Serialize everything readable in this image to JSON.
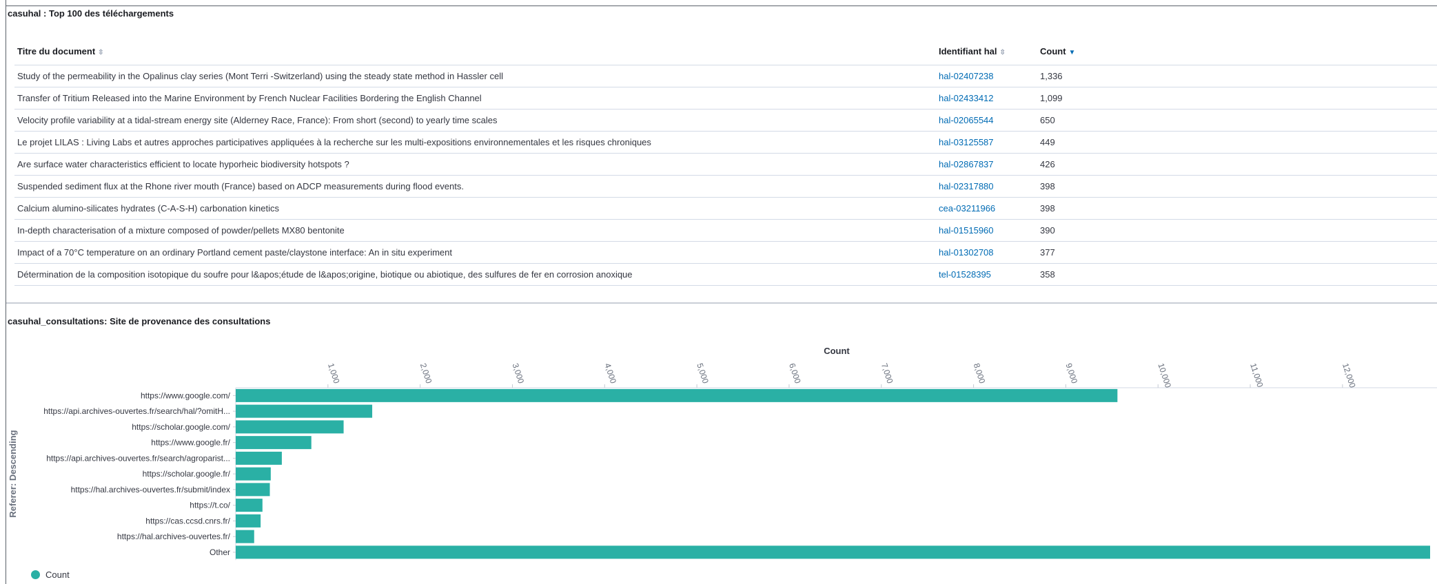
{
  "table_panel": {
    "title": "casuhal : Top 100 des téléchargements",
    "columns": {
      "title": "Titre du document",
      "id": "Identifiant hal",
      "count": "Count"
    },
    "rows": [
      {
        "title": "Study of the permeability in the Opalinus clay series (Mont Terri -Switzerland) using the steady state method in Hassler cell",
        "id": "hal-02407238",
        "count": "1,336"
      },
      {
        "title": "Transfer of Tritium Released into the Marine Environment by French Nuclear Facilities Bordering the English Channel",
        "id": "hal-02433412",
        "count": "1,099"
      },
      {
        "title": "Velocity profile variability at a tidal-stream energy site (Alderney Race, France): From short (second) to yearly time scales",
        "id": "hal-02065544",
        "count": "650"
      },
      {
        "title": "Le projet LILAS : Living Labs et autres approches participatives appliquées à la recherche sur les multi-expositions environnementales et les risques chroniques",
        "id": "hal-03125587",
        "count": "449"
      },
      {
        "title": "Are surface water characteristics efficient to locate hyporheic biodiversity hotspots ?",
        "id": "hal-02867837",
        "count": "426"
      },
      {
        "title": "Suspended sediment flux at the Rhone river mouth (France) based on ADCP measurements during flood events.",
        "id": "hal-02317880",
        "count": "398"
      },
      {
        "title": "Calcium alumino-silicates hydrates (C-A-S-H) carbonation kinetics",
        "id": "cea-03211966",
        "count": "398"
      },
      {
        "title": "In-depth characterisation of a mixture composed of powder/pellets MX80 bentonite",
        "id": "hal-01515960",
        "count": "390"
      },
      {
        "title": "Impact of a 70°C temperature on an ordinary Portland cement paste/claystone interface: An in situ experiment",
        "id": "hal-01302708",
        "count": "377"
      },
      {
        "title": "Détermination de la composition isotopique du soufre pour l&apos;étude de l&apos;origine, biotique ou abiotique, des sulfures de fer en corrosion anoxique",
        "id": "tel-01528395",
        "count": "358"
      }
    ]
  },
  "chart_panel": {
    "title": "casuhal_consultations: Site de provenance des consultations",
    "legend_label": "Count"
  },
  "colors": {
    "bar": "#2ab0a5",
    "link": "#006bb4",
    "border": "#d3dae6"
  },
  "chart_data": {
    "type": "bar",
    "orientation": "horizontal",
    "xlabel": "Count",
    "ylabel": "Referer: Descending",
    "xlim": [
      0,
      12950
    ],
    "x_ticks": [
      1000,
      2000,
      3000,
      4000,
      5000,
      6000,
      7000,
      8000,
      9000,
      10000,
      11000,
      12000
    ],
    "x_tick_labels": [
      "1,000",
      "2,000",
      "3,000",
      "4,000",
      "5,000",
      "6,000",
      "7,000",
      "8,000",
      "9,000",
      "10,000",
      "11,000",
      "12,000"
    ],
    "categories": [
      "https://www.google.com/",
      "https://api.archives-ouvertes.fr/search/hal/?omitH...",
      "https://scholar.google.com/",
      "https://www.google.fr/",
      "https://api.archives-ouvertes.fr/search/agroparist...",
      "https://scholar.google.fr/",
      "https://hal.archives-ouvertes.fr/submit/index",
      "https://t.co/",
      "https://cas.ccsd.cnrs.fr/",
      "https://hal.archives-ouvertes.fr/",
      "Other"
    ],
    "series": [
      {
        "name": "Count",
        "values": [
          9560,
          1480,
          1170,
          820,
          500,
          380,
          370,
          290,
          270,
          200,
          12950
        ]
      }
    ],
    "legend": "bottom-left",
    "grid": false
  }
}
